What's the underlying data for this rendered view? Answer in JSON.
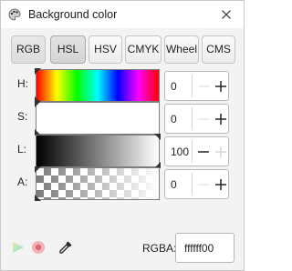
{
  "window": {
    "title": "Background color",
    "icons": [
      "paint-palette-icon",
      "close-icon"
    ]
  },
  "tabs": [
    {
      "label": "RGB"
    },
    {
      "label": "HSL",
      "active": true
    },
    {
      "label": "HSV"
    },
    {
      "label": "CMYK"
    },
    {
      "label": "Wheel"
    },
    {
      "label": "CMS"
    }
  ],
  "channels": [
    {
      "label": "H:",
      "value": "0"
    },
    {
      "label": "S:",
      "value": "0"
    },
    {
      "label": "L:",
      "value": "100"
    },
    {
      "label": "A:",
      "value": "0"
    }
  ],
  "footer": {
    "rgba_label": "RGBA:",
    "rgba_value": "ffffff00",
    "icons": [
      "out-of-gamut-icon",
      "too-much-ink-icon",
      "eyedropper-icon"
    ]
  },
  "colors": {
    "accent_stop": "#e0666e",
    "triangle_marker": "#333333"
  }
}
